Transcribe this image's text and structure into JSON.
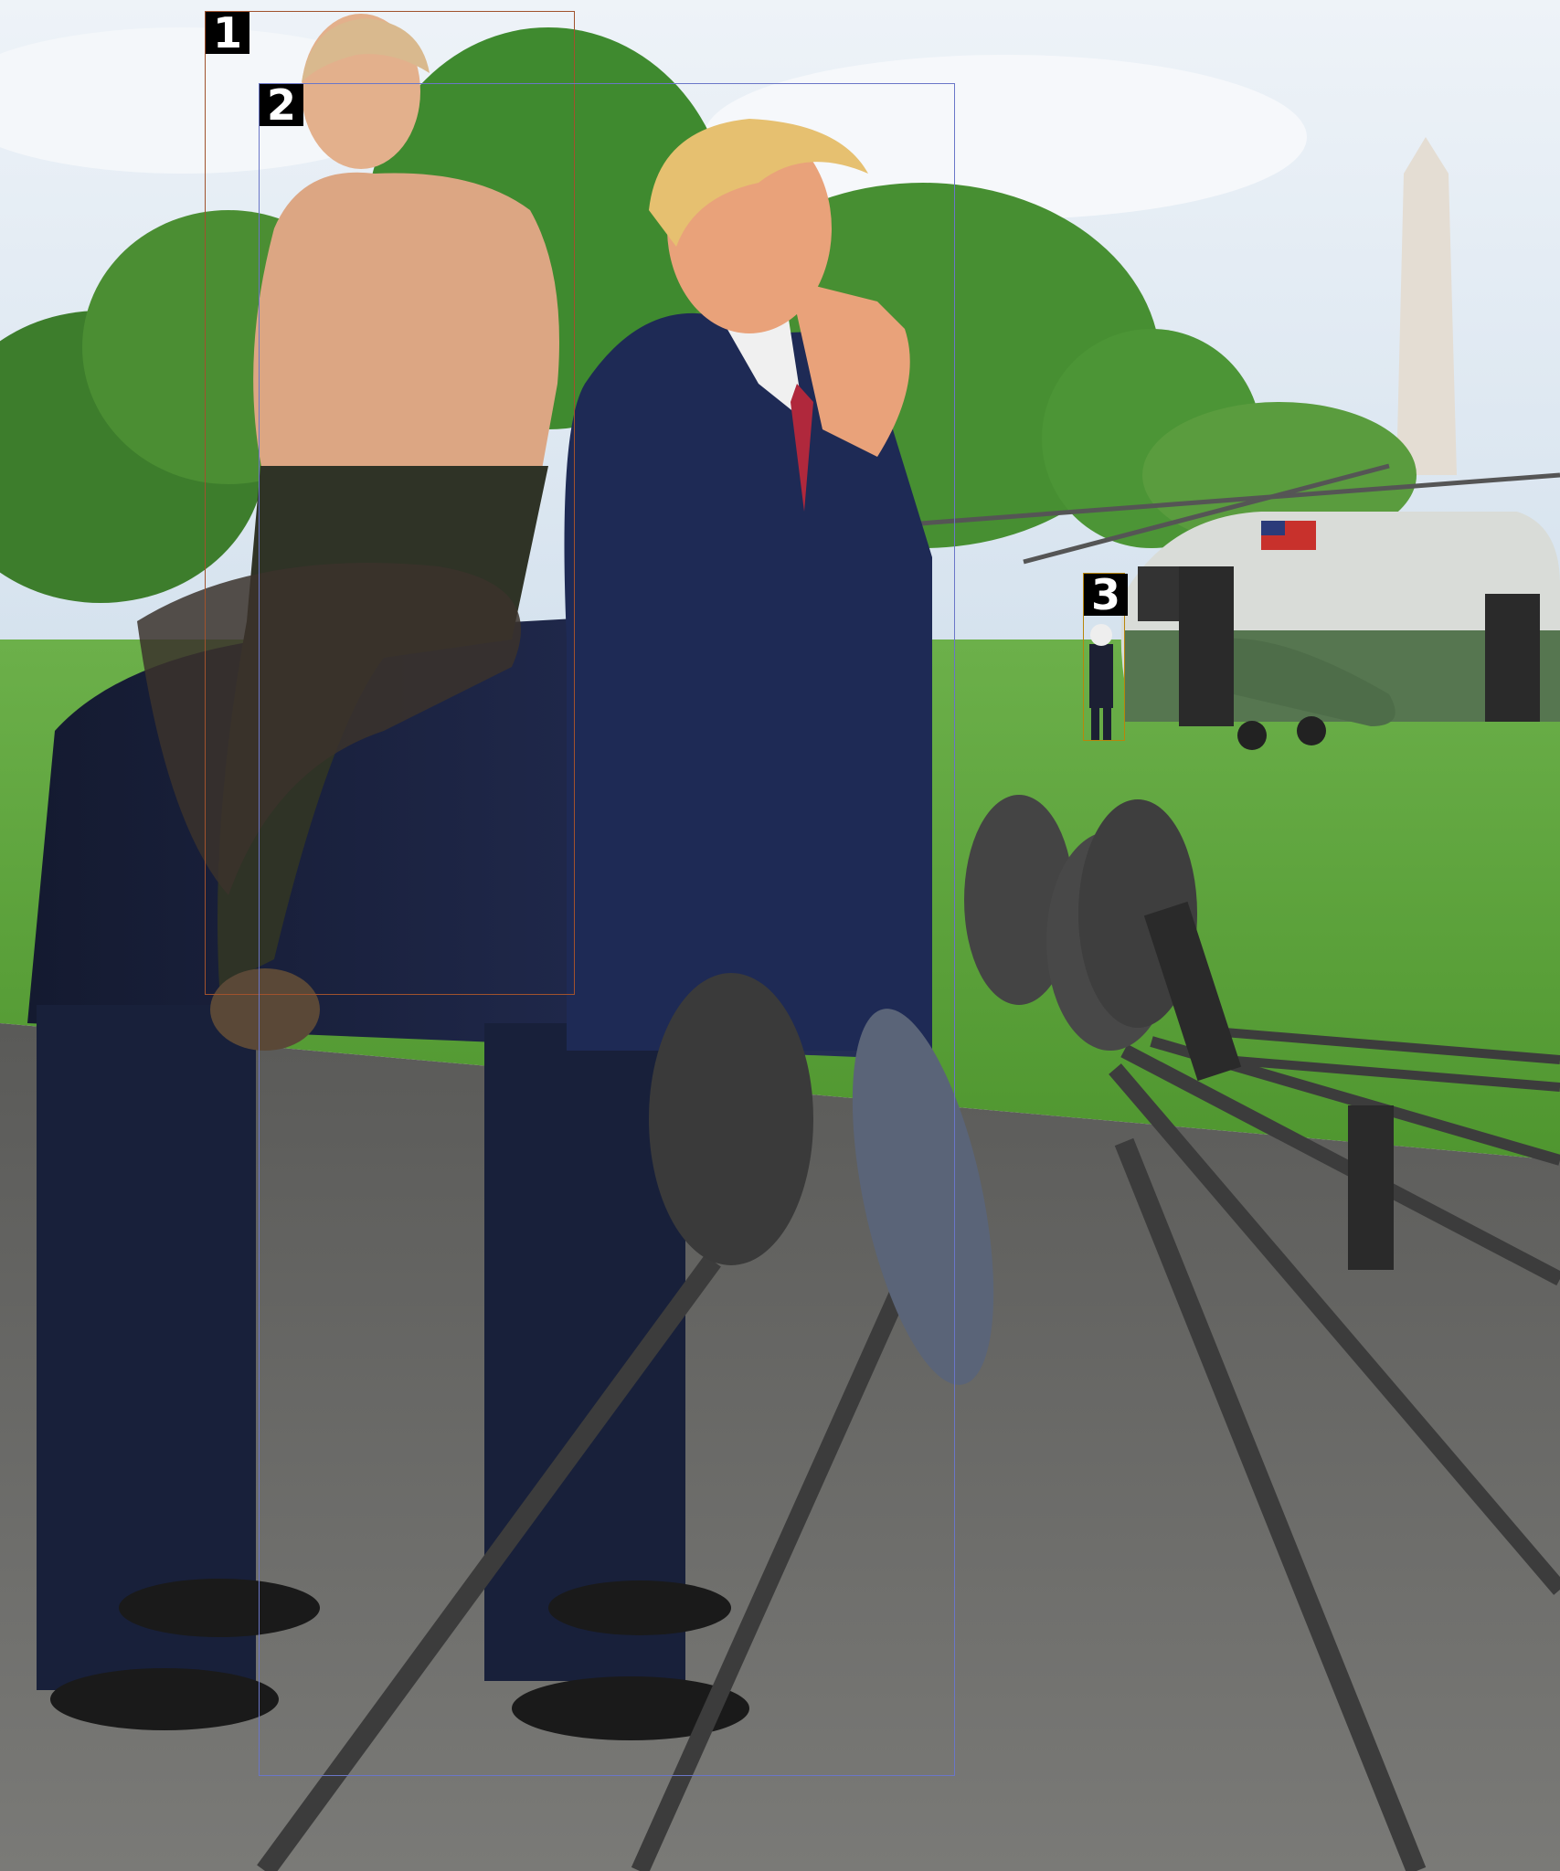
{
  "image": {
    "description_colors": {
      "sky": "#dfe9f2",
      "grass": "#5fa63a",
      "asphalt": "#6d6d6b",
      "suit": "#1b2340",
      "helicopter": "#5f7d5c"
    }
  },
  "annotations": [
    {
      "label": "1",
      "color": "#a0522d"
    },
    {
      "label": "2",
      "color": "#6a76c8"
    },
    {
      "label": "3",
      "color": "#b8860b"
    }
  ]
}
